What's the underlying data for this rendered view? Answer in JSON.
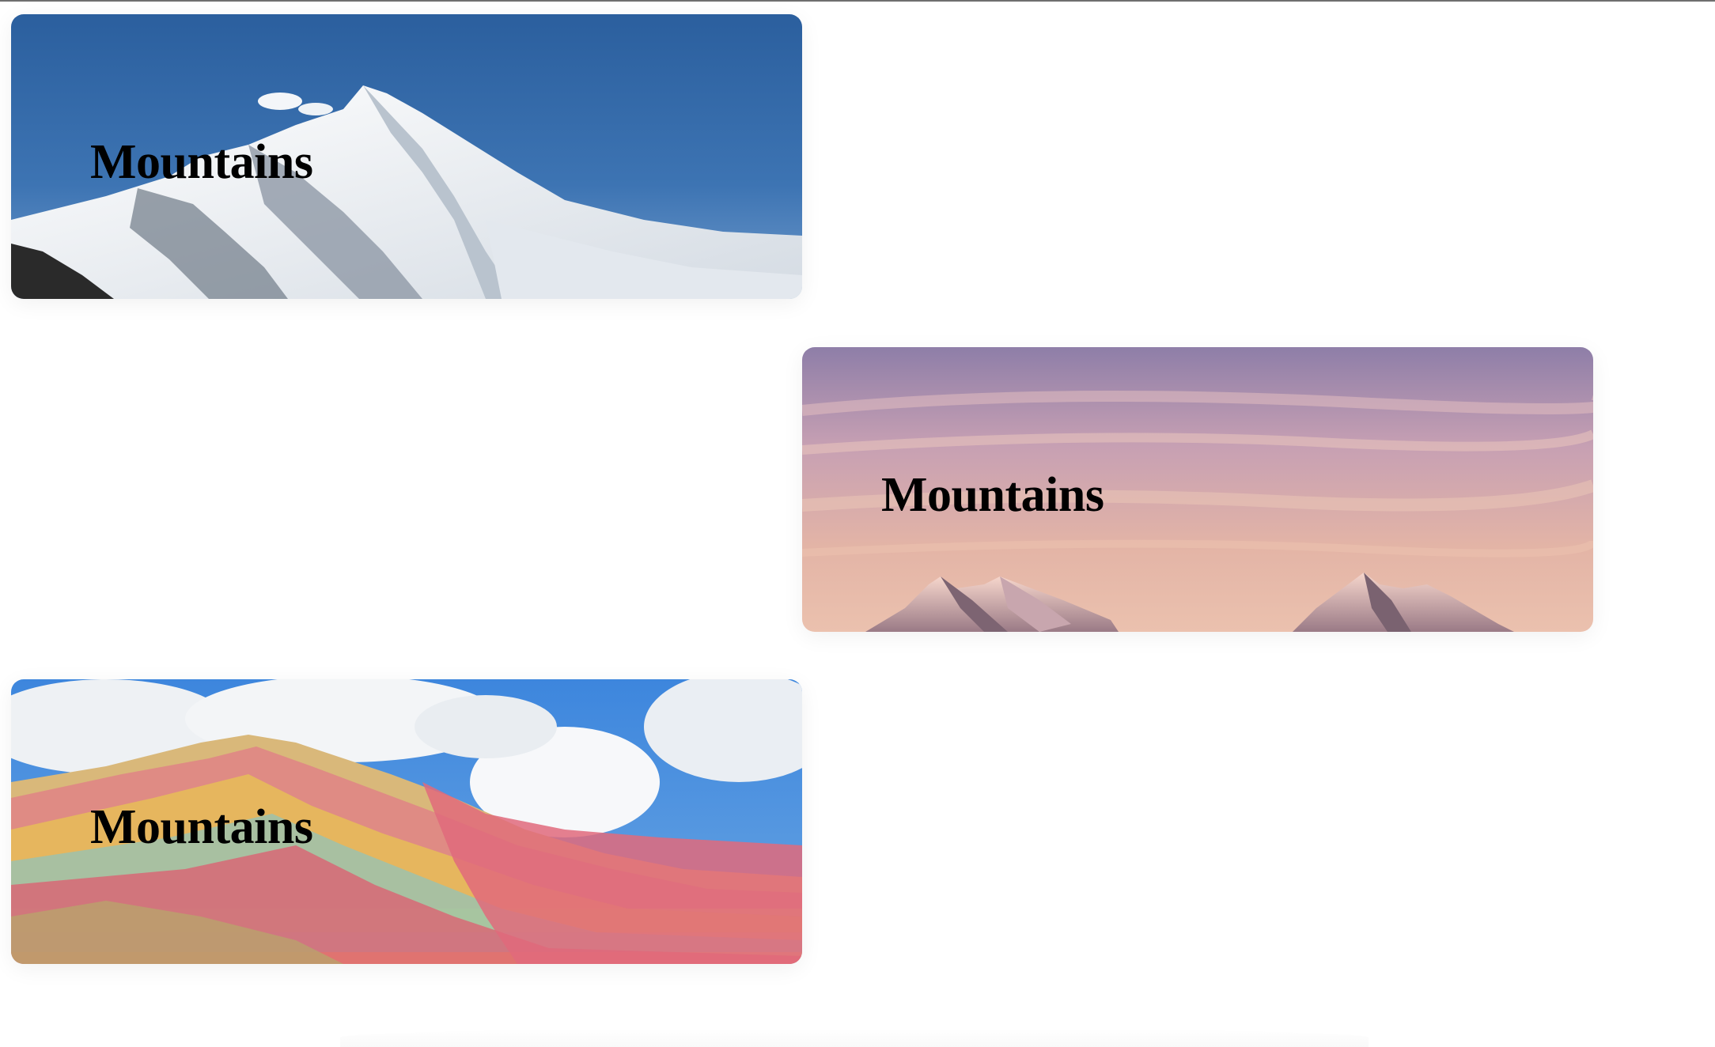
{
  "cards": [
    {
      "title": "Mountains",
      "image": "snowy-peak-blue-sky"
    },
    {
      "title": "Mountains",
      "image": "pink-sunset-peaks"
    },
    {
      "title": "Mountains",
      "image": "rainbow-striped-mountain"
    }
  ]
}
